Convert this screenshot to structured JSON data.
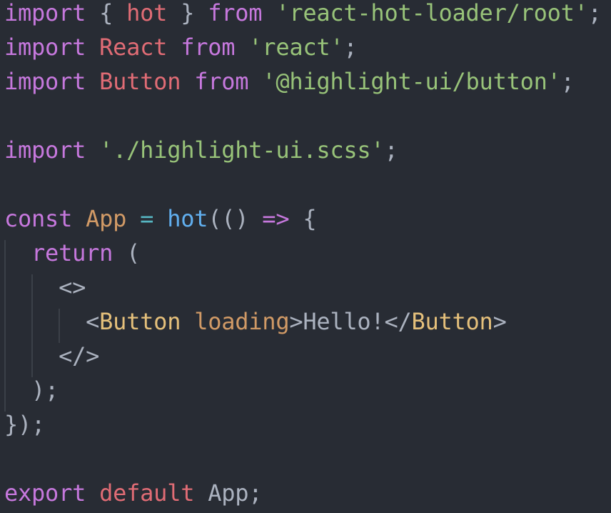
{
  "lines": {
    "l1": {
      "import": "import",
      "open": " { ",
      "hot": "hot",
      "close": " } ",
      "from": "from",
      "space": " ",
      "source": "'react-hot-loader/root'",
      "semi": ";"
    },
    "l2": {
      "import": "import",
      "space1": " ",
      "name": "React",
      "space2": " ",
      "from": "from",
      "space3": " ",
      "source": "'react'",
      "semi": ";"
    },
    "l3": {
      "import": "import",
      "space1": " ",
      "name": "Button",
      "space2": " ",
      "from": "from",
      "space3": " ",
      "source": "'@highlight-ui/button'",
      "semi": ";"
    },
    "l5": {
      "import": "import",
      "space": " ",
      "source": "'./highlight-ui.scss'",
      "semi": ";"
    },
    "l7": {
      "const": "const",
      "space1": " ",
      "name": "App",
      "space2": " ",
      "eq": "=",
      "space3": " ",
      "hot": "hot",
      "parens": "(()",
      "space4": " ",
      "arrow": "=>",
      "space5": " ",
      "brace": "{"
    },
    "l8": {
      "indent": "  ",
      "return": "return",
      "rest": " ("
    },
    "l9": {
      "indent": "    ",
      "frag_open": "<>"
    },
    "l10": {
      "indent": "      ",
      "lt": "<",
      "comp": "Button",
      "space": " ",
      "attr": "loading",
      "gt": ">",
      "text": "Hello!",
      "close_lt": "</",
      "close_comp": "Button",
      "close_gt": ">"
    },
    "l11": {
      "indent": "    ",
      "frag_close": "</>"
    },
    "l12": {
      "indent": "  ",
      "text": ");"
    },
    "l13": {
      "text": "});"
    },
    "l15": {
      "export": "export",
      "space1": " ",
      "default": "default",
      "space2": " ",
      "name": "App",
      "semi": ";"
    }
  }
}
